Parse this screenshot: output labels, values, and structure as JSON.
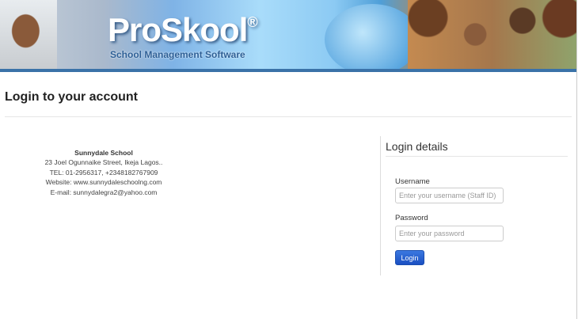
{
  "banner": {
    "logo": "ProSkool",
    "registered": "®",
    "tagline": "School Management Software"
  },
  "page_title": "Login to your account",
  "school": {
    "name": "Sunnydale School",
    "address": "23 Joel Ogunnaike Street, Ikeja Lagos..",
    "tel": "TEL: 01-2956317, +2348182767909",
    "website": "Website: www.sunnydaleschoolng.com",
    "email": "E-mail: sunnydalegra2@yahoo.com"
  },
  "login": {
    "heading": "Login details",
    "username_label": "Username",
    "username_placeholder": "Enter your username (Staff ID)",
    "password_label": "Password",
    "password_placeholder": "Enter your password",
    "button": "Login"
  }
}
